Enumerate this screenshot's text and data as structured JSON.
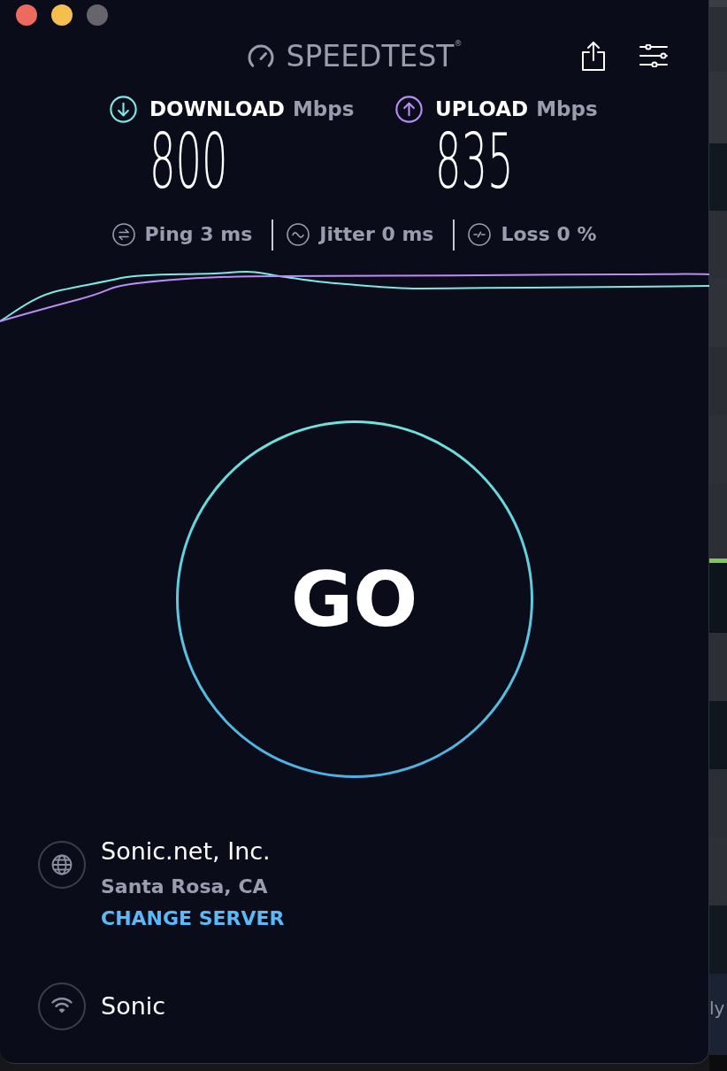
{
  "window": {
    "controls": [
      {
        "color": "#ec6a5e"
      },
      {
        "color": "#f4bf4f"
      },
      {
        "color": "#66656b"
      }
    ]
  },
  "header": {
    "logo": "SPEEDTEST$^{®}$"
  },
  "results": [
    {
      "kind": "download",
      "label": "DOWNLOAD",
      "unit": "Mbps",
      "value": "800",
      "color": "#7ee8e6"
    },
    {
      "kind": "upload",
      "label": "UPLOAD",
      "unit": "Mbps",
      "value": "835",
      "color": "#b98df4"
    }
  ],
  "stats": [
    {
      "kind": "ping",
      "text": "Ping 3 ms"
    },
    {
      "kind": "jitter",
      "text": "Jitter 0 ms"
    },
    {
      "kind": "loss",
      "text": "Loss 0 %"
    }
  ],
  "go_button": {
    "label": "GO"
  },
  "server": {
    "provider": "Sonic.net, Inc.",
    "location": "Santa Rosa, CA",
    "link": "CHANGE SERVER"
  },
  "connection": {
    "name": "Sonic"
  },
  "backdrop": {
    "text": "ly"
  }
}
